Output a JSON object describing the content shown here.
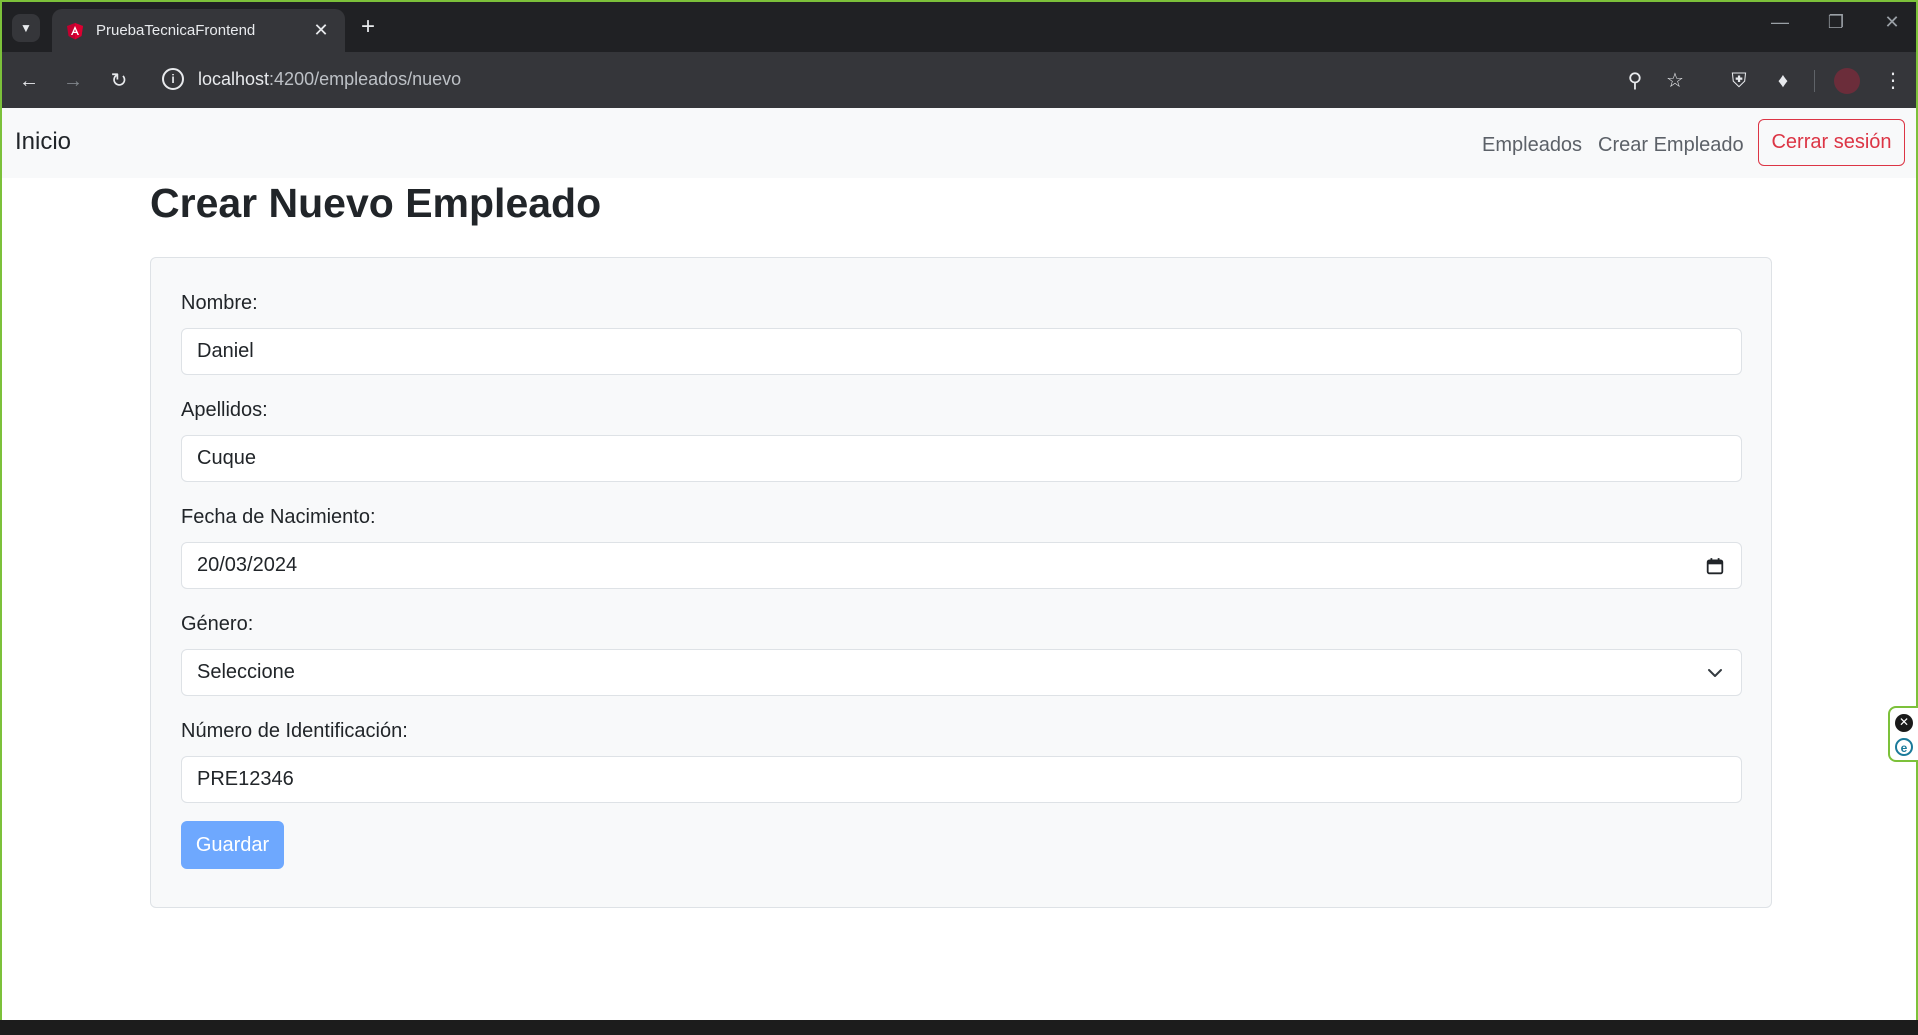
{
  "browser": {
    "tab_title": "PruebaTecnicaFrontend",
    "url_host": "localhost",
    "url_rest": ":4200/empleados/nuevo",
    "accent": "#7cc13a"
  },
  "navbar": {
    "brand": "Inicio",
    "links": [
      "Empleados",
      "Crear Empleado"
    ],
    "logout_label": "Cerrar sesión"
  },
  "page": {
    "title": "Crear Nuevo Empleado"
  },
  "form": {
    "nombre_label": "Nombre:",
    "nombre_value": "Daniel",
    "apellidos_label": "Apellidos:",
    "apellidos_value": "Cuque",
    "fecha_label": "Fecha de Nacimiento:",
    "fecha_value": "20/03/2024",
    "genero_label": "Género:",
    "genero_value": "Seleccione",
    "identificacion_label": "Número de Identificación:",
    "identificacion_value": "PRE12346",
    "save_label": "Guardar"
  },
  "colors": {
    "primary_light": "#6ea8fe",
    "danger": "#dc3545"
  }
}
